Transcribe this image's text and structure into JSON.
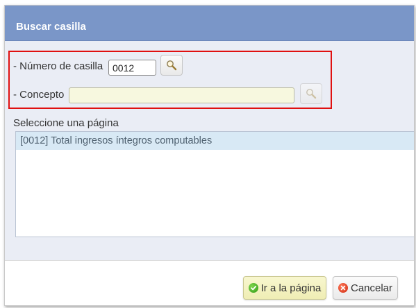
{
  "dialog": {
    "title": "Buscar casilla"
  },
  "search": {
    "casilla_label": "- Número de casilla",
    "casilla_value": "0012",
    "concepto_label": "- Concepto",
    "concepto_value": ""
  },
  "results": {
    "label": "Seleccione una página",
    "items": [
      "[0012] Total ingresos íntegros computables"
    ]
  },
  "footer": {
    "ok_label": "Ir a la página",
    "cancel_label": "Cancelar"
  },
  "colors": {
    "titlebar": "#7a96c8",
    "highlight_border": "#e01010",
    "selected_row": "#d8e9f5",
    "concepto_bg": "#f7f8df"
  },
  "icons": {
    "search": "magnifier-icon",
    "ok": "green-check-icon",
    "cancel": "red-x-icon"
  }
}
